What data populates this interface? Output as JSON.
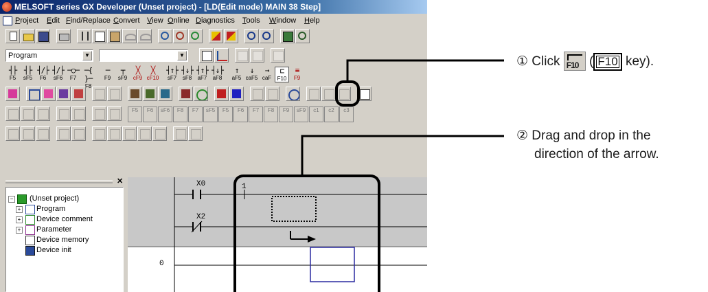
{
  "window": {
    "title": "MELSOFT series GX Developer (Unset project) - [LD(Edit mode)    MAIN    38 Step]"
  },
  "menu": [
    {
      "label": "Project",
      "hot": "P"
    },
    {
      "label": "Edit",
      "hot": "E"
    },
    {
      "label": "Find/Replace",
      "hot": "F"
    },
    {
      "label": "Convert",
      "hot": "C"
    },
    {
      "label": "View",
      "hot": "V"
    },
    {
      "label": "Online",
      "hot": "O"
    },
    {
      "label": "Diagnostics",
      "hot": "D"
    },
    {
      "label": "Tools",
      "hot": "T"
    },
    {
      "label": "Window",
      "hot": "W"
    },
    {
      "label": "Help",
      "hot": "H"
    }
  ],
  "toolbar": {
    "data_type_select": "Program",
    "secondary_select": ""
  },
  "ladder_keys": [
    {
      "sym": "┤├",
      "key": "F5"
    },
    {
      "sym": "┤├",
      "key": "sF5"
    },
    {
      "sym": "┤/├",
      "key": "F6"
    },
    {
      "sym": "┤/├",
      "key": "sF6"
    },
    {
      "sym": "─○─",
      "key": "F7"
    },
    {
      "sym": "─{ }─",
      "key": "F8"
    },
    {
      "sym": "─",
      "key": "F9"
    },
    {
      "sym": "┬",
      "key": "sF9"
    },
    {
      "sym": "╳",
      "key": "cF9"
    },
    {
      "sym": "╳",
      "key": "cF10"
    },
    {
      "sym": "┤↑├",
      "key": "sF7"
    },
    {
      "sym": "┤↓├",
      "key": "sF8"
    },
    {
      "sym": "┤↑├",
      "key": "aF7"
    },
    {
      "sym": "┤↓├",
      "key": "aF8"
    },
    {
      "sym": "↑",
      "key": "aF5"
    },
    {
      "sym": "↓",
      "key": "caF5"
    },
    {
      "sym": "→",
      "key": "caF"
    },
    {
      "sym": "⊏",
      "key": "F10"
    },
    {
      "sym": "≡",
      "key": "F9"
    }
  ],
  "ladder_keys_row2": [
    {
      "key": "F5"
    },
    {
      "key": "F6"
    },
    {
      "key": "sF6"
    },
    {
      "key": "F8"
    },
    {
      "key": "F7"
    },
    {
      "key": "sF5"
    },
    {
      "key": "F5"
    },
    {
      "key": "F6"
    },
    {
      "key": "F7"
    },
    {
      "key": "F8"
    },
    {
      "key": "F9"
    },
    {
      "key": "sF9"
    },
    {
      "key": "c1"
    },
    {
      "key": "c2"
    },
    {
      "key": "c3"
    }
  ],
  "project_tree": {
    "root": "(Unset project)",
    "items": [
      {
        "label": "Program",
        "expand": "+"
      },
      {
        "label": "Device comment",
        "expand": "+"
      },
      {
        "label": "Parameter",
        "expand": "+"
      },
      {
        "label": "Device memory",
        "expand": ""
      },
      {
        "label": "Device init",
        "expand": ""
      }
    ]
  },
  "ladder": {
    "contact1": "X0",
    "contact2": "X2",
    "step_marker": "1",
    "step_number": "0"
  },
  "annotations": {
    "step1_prefix": "① Click",
    "step1_open": "(",
    "step1_key": "F10",
    "step1_suffix": "key).",
    "step1_icon_key": "F10",
    "step2_line1": "② Drag and drop in the",
    "step2_line2": "direction of the arrow."
  },
  "colors": {
    "titlebar_start": "#0a246a",
    "window_face": "#d4d0c8",
    "ladder_rung_bg": "#c8c8c8",
    "selection_box": "#2a2aa0"
  }
}
